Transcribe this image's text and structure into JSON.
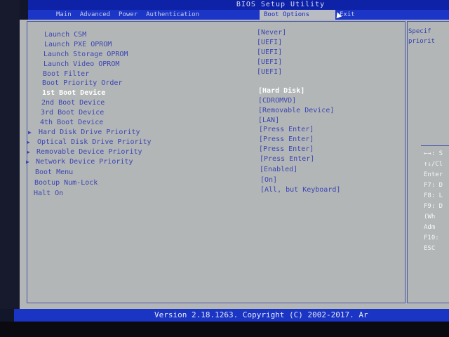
{
  "window": {
    "title": "BIOS Setup Utility"
  },
  "menu": [
    {
      "label": "Main"
    },
    {
      "label": "Advanced"
    },
    {
      "label": "Power"
    },
    {
      "label": "Authentication"
    },
    {
      "label": ""
    },
    {
      "label": "Boot Options"
    },
    {
      "label": "Exit"
    }
  ],
  "settings": [
    {
      "label": "Launch CSM",
      "value": "[Never]"
    },
    {
      "label": "Launch PXE OPROM",
      "value": "[UEFI]"
    },
    {
      "label": "Launch Storage OPROM",
      "value": "[UEFI]"
    },
    {
      "label": "Launch Video OPROM",
      "value": "[UEFI]"
    },
    {
      "label": "Boot Filter",
      "value": "[UEFI]"
    },
    {
      "label": "Boot Priority Order",
      "value": ""
    },
    {
      "label": "1st Boot Device",
      "value": "[Hard Disk]"
    },
    {
      "label": "2nd Boot Device",
      "value": "[CDROMVD]"
    },
    {
      "label": "3rd Boot Device",
      "value": "[Removable Device]"
    },
    {
      "label": "4th Boot Device",
      "value": "[LAN]"
    },
    {
      "label": "Hard Disk Drive Priority",
      "value": "[Press Enter]"
    },
    {
      "label": "Optical Disk Drive Priority",
      "value": "[Press Enter]"
    },
    {
      "label": "Removable Device Priority",
      "value": "[Press Enter]"
    },
    {
      "label": "Network Device Priority",
      "value": "[Press Enter]"
    },
    {
      "label": "Boot Menu",
      "value": "[Enabled]"
    },
    {
      "label": "Bootup Num-Lock",
      "value": "[On]"
    },
    {
      "label": "Halt On",
      "value": "[All, but Keyboard]"
    }
  ],
  "help": {
    "lines": [
      "Specif",
      "priorit"
    ],
    "keys": [
      "←→: S",
      "↑↓/Cl",
      "Enter",
      "F7: D",
      "F8: L",
      "F9: D",
      "(Wh",
      "Adm",
      "F10:",
      "ESC"
    ]
  },
  "footer": {
    "text": "Version 2.18.1263. Copyright (C) 2002-2017. Ar"
  },
  "colors": {
    "menu_bar": "#1b35c7",
    "panel": "#b3b6b6",
    "text": "#3b46b4",
    "highlight": "#ffffff"
  }
}
